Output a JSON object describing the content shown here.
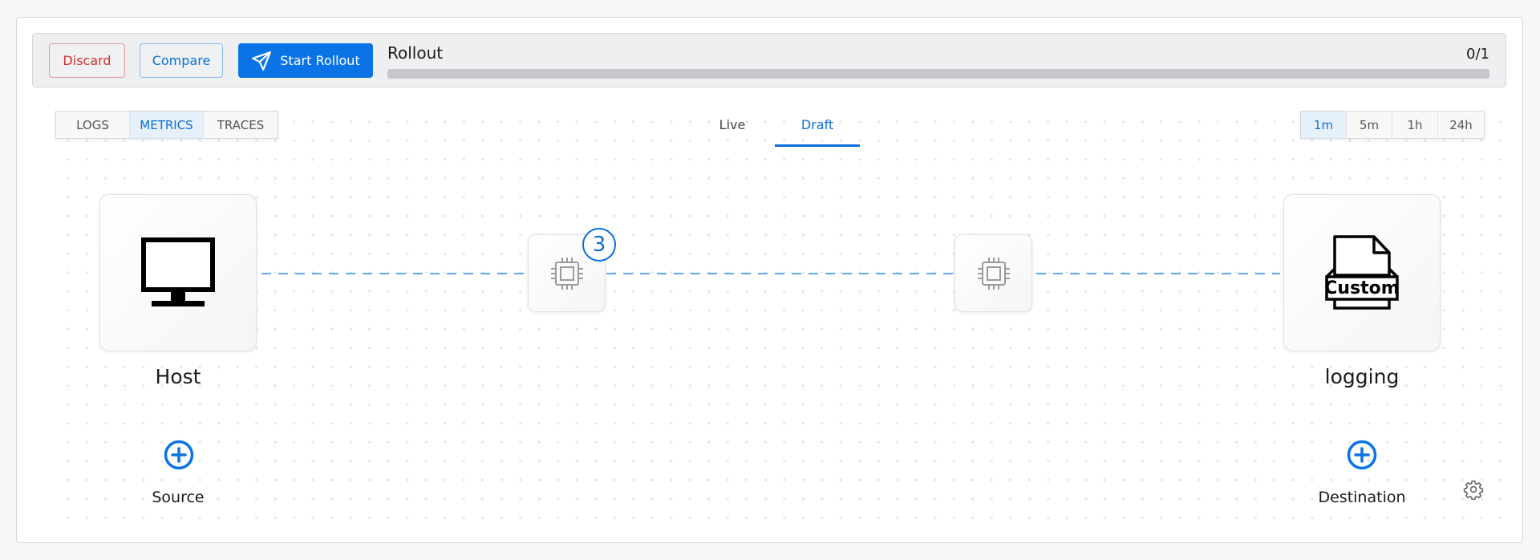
{
  "toolbar": {
    "discard_label": "Discard",
    "compare_label": "Compare",
    "start_label": "Start Rollout",
    "rollout_title": "Rollout",
    "rollout_count": "0/1",
    "rollout_progress": 0
  },
  "telemetry_types": [
    {
      "label": "LOGS",
      "active": false
    },
    {
      "label": "METRICS",
      "active": true
    },
    {
      "label": "TRACES",
      "active": false
    }
  ],
  "view_tabs": [
    {
      "label": "Live",
      "active": false
    },
    {
      "label": "Draft",
      "active": true
    }
  ],
  "time_ranges": [
    {
      "label": "1m",
      "active": true
    },
    {
      "label": "5m",
      "active": false
    },
    {
      "label": "1h",
      "active": false
    },
    {
      "label": "24h",
      "active": false
    }
  ],
  "pipeline": {
    "source": {
      "name": "Host",
      "icon": "monitor-icon"
    },
    "processors": [
      {
        "icon": "processor-chip-icon",
        "badge": "3"
      },
      {
        "icon": "processor-chip-icon",
        "badge": null
      }
    ],
    "destination": {
      "name": "logging",
      "icon": "custom-file-icon",
      "icon_text": "Custom"
    },
    "add_source_label": "Source",
    "add_destination_label": "Destination"
  },
  "colors": {
    "accent": "#0a73e6",
    "danger": "#d32f2f",
    "connector": "#5aa8f0"
  }
}
